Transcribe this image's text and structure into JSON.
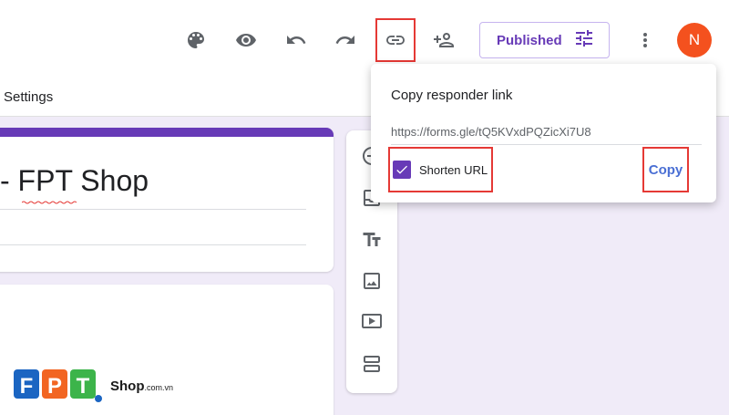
{
  "tabs": {
    "settings": "Settings"
  },
  "toolbar": {
    "icons": [
      "palette-icon",
      "preview-icon",
      "undo-icon",
      "redo-icon",
      "link-icon",
      "add-collaborator-icon",
      "tune-icon",
      "more-vert-icon"
    ],
    "published_label": "Published",
    "avatar_initial": "N"
  },
  "form": {
    "title": "- FPT Shop"
  },
  "popup": {
    "title": "Copy responder link",
    "url": "https://forms.gle/tQ5KVxdPQZicXi7U8",
    "shorten_label": "Shorten URL",
    "shorten_checked": true,
    "copy_label": "Copy"
  },
  "side_toolbar": {
    "icons": [
      "add-question-icon",
      "import-questions-icon",
      "add-title-icon",
      "add-image-icon",
      "add-video-icon",
      "add-section-icon"
    ]
  },
  "watermark": {
    "brand": "FPT",
    "shop": "Shop",
    "domain": ".com.vn"
  },
  "colors": {
    "accent": "#673ab7",
    "avatar": "#f4511e",
    "copy": "#4a6fd4",
    "highlight": "#e53935",
    "background": "#f0ebf8"
  }
}
